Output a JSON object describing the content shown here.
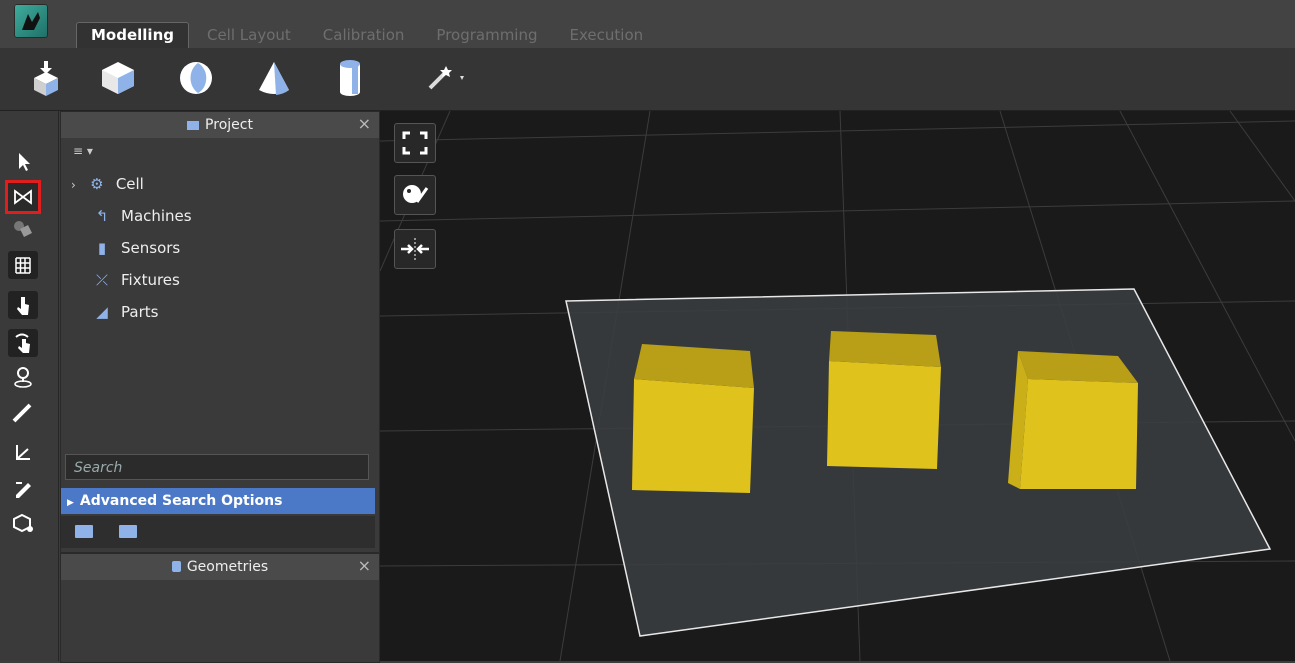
{
  "window": {
    "tabs": [
      {
        "label": "Modelling",
        "active": true
      },
      {
        "label": "Cell Layout",
        "active": false
      },
      {
        "label": "Calibration",
        "active": false
      },
      {
        "label": "Programming",
        "active": false
      },
      {
        "label": "Execution",
        "active": false
      }
    ]
  },
  "toolbar": {
    "buttons": [
      "import-geometry-icon",
      "cube-icon",
      "sphere-icon",
      "cone-icon",
      "cylinder-icon",
      "magic-wand-icon"
    ]
  },
  "left_tools": [
    "select-arrow-icon",
    "frame-select-icon",
    "paint-bucket-icon",
    "grid-icon",
    "move-hand-icon",
    "rotate-hand-icon",
    "location-pin-icon",
    "ruler-icon",
    "axis-icon",
    "edit-icon",
    "cube-settings-icon"
  ],
  "project_panel": {
    "title": "Project",
    "close": "×",
    "menu": "≡ ▾",
    "items": [
      {
        "label": "Cell",
        "icon": "cell-icon",
        "expander": "›"
      },
      {
        "label": "Machines",
        "icon": "robot-arm-icon"
      },
      {
        "label": "Sensors",
        "icon": "sensor-icon"
      },
      {
        "label": "Fixtures",
        "icon": "fixture-icon"
      },
      {
        "label": "Parts",
        "icon": "part-icon"
      }
    ],
    "search_placeholder": "Search",
    "advanced_search": "Advanced Search Options"
  },
  "geometries_panel": {
    "title": "Geometries",
    "close": "×"
  },
  "viewport": {
    "buttons": [
      "fullscreen-icon",
      "appearance-icon",
      "fit-view-icon"
    ],
    "box_color": "#e0c21c",
    "plane_color": "#3a3d40"
  }
}
